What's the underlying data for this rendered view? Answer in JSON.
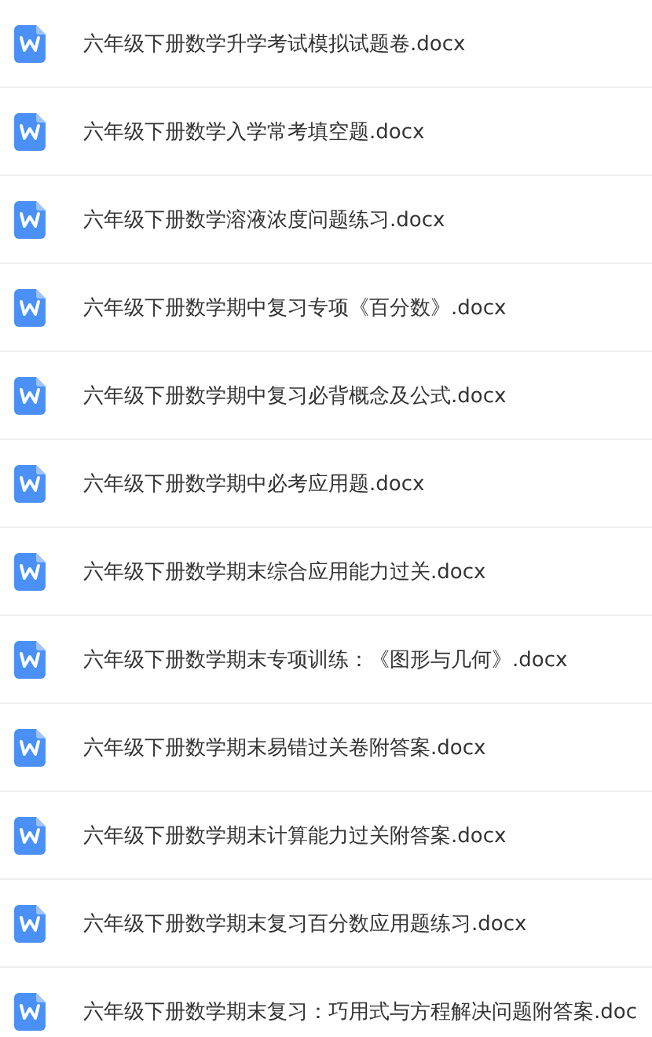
{
  "files": [
    {
      "name": "六年级下册数学升学考试模拟试题卷.docx"
    },
    {
      "name": "六年级下册数学入学常考填空题.docx"
    },
    {
      "name": "六年级下册数学溶液浓度问题练习.docx"
    },
    {
      "name": "六年级下册数学期中复习专项《百分数》.docx"
    },
    {
      "name": "六年级下册数学期中复习必背概念及公式.docx"
    },
    {
      "name": "六年级下册数学期中必考应用题.docx"
    },
    {
      "name": "六年级下册数学期末综合应用能力过关.docx"
    },
    {
      "name": "六年级下册数学期末专项训练：《图形与几何》.docx"
    },
    {
      "name": "六年级下册数学期末易错过关卷附答案.docx"
    },
    {
      "name": "六年级下册数学期末计算能力过关附答案.docx"
    },
    {
      "name": "六年级下册数学期末复习百分数应用题练习.docx"
    },
    {
      "name": "六年级下册数学期末复习：巧用式与方程解决问题附答案.doc"
    }
  ]
}
